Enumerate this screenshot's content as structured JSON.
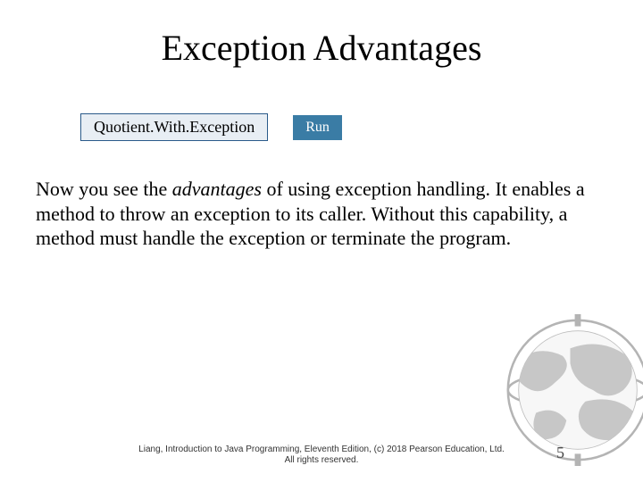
{
  "title": "Exception Advantages",
  "buttons": {
    "codeLabel": "Quotient.With.Exception",
    "runLabel": "Run"
  },
  "body": {
    "seg1": "Now you see the ",
    "italic": "advantages",
    "seg2": " of using exception handling. It enables a method to throw an exception to its caller. Without this capability, a method must handle the exception or terminate the program."
  },
  "footer": {
    "line1": "Liang, Introduction to Java Programming, Eleventh Edition, (c) 2018 Pearson Education, Ltd.",
    "line2": "All rights reserved."
  },
  "pageNumber": "5"
}
